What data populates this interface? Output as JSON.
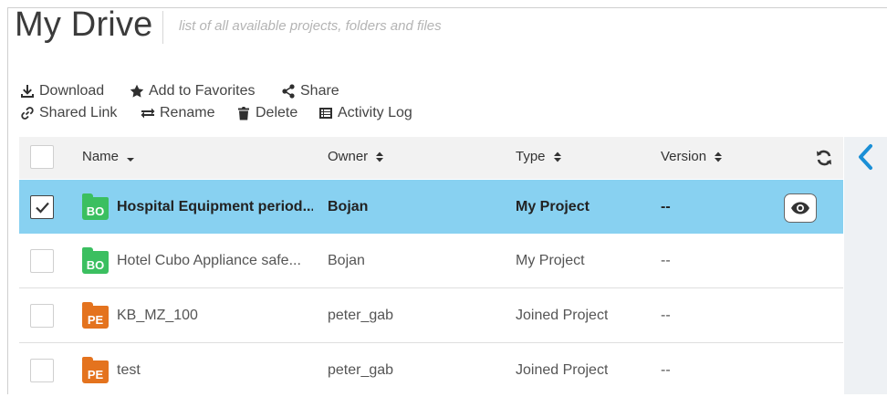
{
  "header": {
    "title": "My Drive",
    "subtitle": "list of all available projects, folders and files"
  },
  "toolbar": {
    "download": "Download",
    "favorites": "Add to Favorites",
    "share": "Share",
    "shared_link": "Shared Link",
    "rename": "Rename",
    "delete": "Delete",
    "activity_log": "Activity Log"
  },
  "table": {
    "columns": {
      "name": "Name",
      "owner": "Owner",
      "type": "Type",
      "version": "Version"
    },
    "rows": [
      {
        "badge": "BO",
        "name": "Hospital Equipment period...",
        "owner": "Bojan",
        "type": "My Project",
        "version": "--",
        "selected": true
      },
      {
        "badge": "BO",
        "name": "Hotel Cubo Appliance safe...",
        "owner": "Bojan",
        "type": "My Project",
        "version": "--",
        "selected": false
      },
      {
        "badge": "PE",
        "name": "KB_MZ_100",
        "owner": "peter_gab",
        "type": "Joined Project",
        "version": "--",
        "selected": false
      },
      {
        "badge": "PE",
        "name": "test",
        "owner": "peter_gab",
        "type": "Joined Project",
        "version": "--",
        "selected": false
      }
    ]
  },
  "colors": {
    "selected_row": "#88d1f1",
    "bo_badge": "#3bbf60",
    "pe_badge": "#e4731e",
    "accent": "#1a8fd6"
  }
}
